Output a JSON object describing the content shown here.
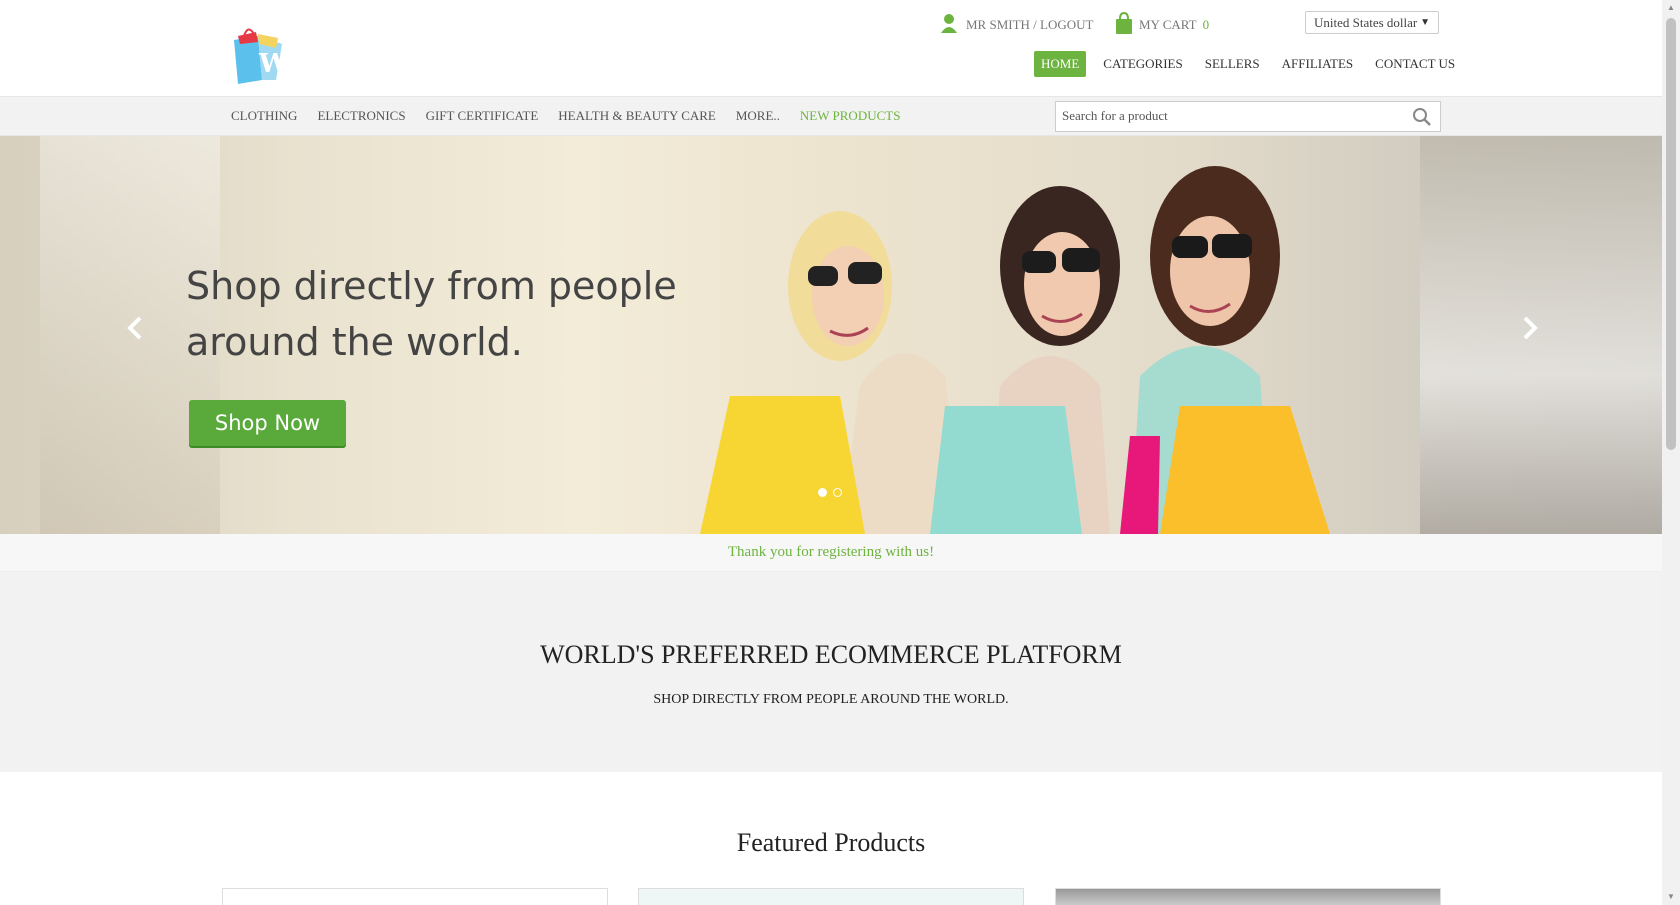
{
  "header": {
    "user_link": "MR SMITH / LOGOUT",
    "cart_label": "MY CART",
    "cart_count": "0",
    "currency": "United States dollar",
    "nav": [
      {
        "label": "HOME",
        "active": true
      },
      {
        "label": "CATEGORIES"
      },
      {
        "label": "SELLERS"
      },
      {
        "label": "AFFILIATES"
      },
      {
        "label": "CONTACT US"
      }
    ]
  },
  "categories": [
    {
      "label": "CLOTHING"
    },
    {
      "label": "ELECTRONICS"
    },
    {
      "label": "GIFT CERTIFICATE"
    },
    {
      "label": "HEALTH & BEAUTY CARE"
    },
    {
      "label": "MORE.."
    },
    {
      "label": "NEW PRODUCTS",
      "highlight": true
    }
  ],
  "search": {
    "placeholder": "Search for a product"
  },
  "hero": {
    "headline_line1": "Shop directly from people",
    "headline_line2": "around the world.",
    "cta": "Shop Now",
    "slide_count": 2,
    "active_slide": 1
  },
  "message": "Thank you for registering with us!",
  "intro": {
    "title": "WORLD'S PREFERRED ECOMMERCE PLATFORM",
    "subtitle": "SHOP DIRECTLY FROM PEOPLE AROUND THE WORLD."
  },
  "featured": {
    "title": "Featured Products"
  },
  "colors": {
    "accent": "#6db33f",
    "button": "#5aaa3b"
  },
  "icons": [
    "logo-bag-icon",
    "user-icon",
    "cart-bag-icon",
    "search-icon",
    "chevron-left-icon",
    "chevron-right-icon"
  ]
}
